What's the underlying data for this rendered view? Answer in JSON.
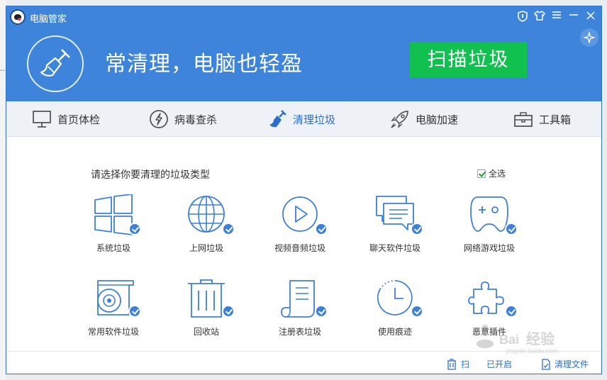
{
  "window": {
    "title": "电脑管家",
    "controls": [
      "shield-icon",
      "shirt-icon",
      "menu-icon",
      "minimize-icon",
      "close-icon"
    ]
  },
  "header": {
    "slogan": "常清理，电脑也轻盈",
    "scan_button": "扫描垃圾",
    "accent": "#3d84da",
    "button_color": "#11c14f"
  },
  "nav": {
    "items": [
      {
        "label": "首页体检",
        "icon": "monitor-icon"
      },
      {
        "label": "病毒查杀",
        "icon": "lightning-icon"
      },
      {
        "label": "清理垃圾",
        "icon": "broom-icon",
        "active": true
      },
      {
        "label": "电脑加速",
        "icon": "rocket-icon"
      },
      {
        "label": "工具箱",
        "icon": "toolbox-icon"
      }
    ]
  },
  "content": {
    "section_title": "请选择你要清理的垃圾类型",
    "select_all": {
      "label": "全选",
      "checked": true
    },
    "categories": [
      {
        "label": "系统垃圾",
        "icon": "windows-icon",
        "checked": true
      },
      {
        "label": "上网垃圾",
        "icon": "globe-icon",
        "checked": true
      },
      {
        "label": "视频音频垃圾",
        "icon": "play-icon",
        "checked": true
      },
      {
        "label": "聊天软件垃圾",
        "icon": "chat-icon",
        "checked": true
      },
      {
        "label": "网络游戏垃圾",
        "icon": "gamepad-icon",
        "checked": true
      },
      {
        "label": "常用软件垃圾",
        "icon": "disc-icon",
        "checked": true
      },
      {
        "label": "回收站",
        "icon": "trash-icon",
        "checked": true
      },
      {
        "label": "注册表垃圾",
        "icon": "scroll-icon",
        "checked": true
      },
      {
        "label": "使用痕迹",
        "icon": "clock-icon",
        "checked": true
      },
      {
        "label": "恶意插件",
        "icon": "puzzle-icon",
        "checked": true
      }
    ]
  },
  "footer": {
    "auto_scan_label": "扫",
    "auto_scan_status": "已开启",
    "clean_file_label": "清理文件"
  },
  "watermark": "Baidu 经验"
}
